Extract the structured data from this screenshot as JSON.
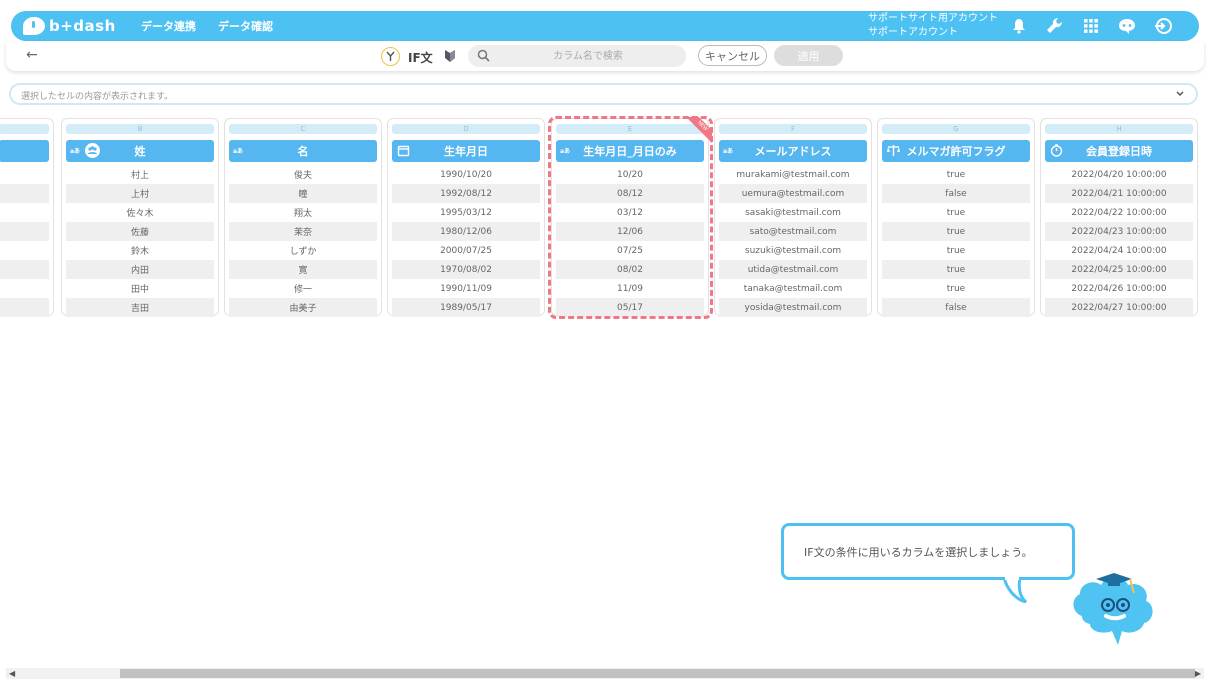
{
  "nav": {
    "logo_text": "b+dash",
    "links": [
      "データ連携",
      "データ確認"
    ],
    "account_line1": "サポートサイト用アカウント",
    "account_line2": "サポートアカウント",
    "icons": [
      "bell-icon",
      "wrench-icon",
      "grid-icon",
      "chat-icon",
      "logout-icon"
    ]
  },
  "toolbar": {
    "back_icon": "back-arrow-icon",
    "if_label": "IF文",
    "search_placeholder": "カラム名で検索",
    "cancel_label": "キャンセル",
    "apply_label": "適用"
  },
  "cell_bar": {
    "placeholder": "選択したセルの内容が表示されます。"
  },
  "columns": [
    {
      "letter": "B",
      "title": "姓",
      "type": "text",
      "cells": [
        "村上",
        "上村",
        "佐々木",
        "佐藤",
        "鈴木",
        "内田",
        "田中",
        "吉田"
      ]
    },
    {
      "letter": "C",
      "title": "名",
      "type": "text",
      "cells": [
        "俊夫",
        "瞳",
        "翔太",
        "茉奈",
        "しずか",
        "寛",
        "修一",
        "由美子"
      ]
    },
    {
      "letter": "D",
      "title": "生年月日",
      "type": "date",
      "cells": [
        "1990/10/20",
        "1992/08/12",
        "1995/03/12",
        "1980/12/06",
        "2000/07/25",
        "1970/08/02",
        "1990/11/09",
        "1989/05/17"
      ]
    },
    {
      "letter": "E",
      "title": "生年月日_月日のみ",
      "type": "text",
      "tag": "NEW",
      "cells": [
        "10/20",
        "08/12",
        "03/12",
        "12/06",
        "07/25",
        "08/02",
        "11/09",
        "05/17"
      ]
    },
    {
      "letter": "F",
      "title": "メールアドレス",
      "type": "text",
      "cells": [
        "murakami@testmail.com",
        "uemura@testmail.com",
        "sasaki@testmail.com",
        "sato@testmail.com",
        "suzuki@testmail.com",
        "utida@testmail.com",
        "tanaka@testmail.com",
        "yosida@testmail.com"
      ]
    },
    {
      "letter": "G",
      "title": "メルマガ許可フラグ",
      "type": "boolean",
      "cells": [
        "true",
        "false",
        "true",
        "true",
        "true",
        "true",
        "true",
        "false"
      ]
    },
    {
      "letter": "H",
      "title": "会員登録日時",
      "type": "datetime",
      "cells": [
        "2022/04/20 10:00:00",
        "2022/04/21 10:00:00",
        "2022/04/22 10:00:00",
        "2022/04/23 10:00:00",
        "2022/04/24 10:00:00",
        "2022/04/25 10:00:00",
        "2022/04/26 10:00:00",
        "2022/04/27 10:00:00"
      ]
    }
  ],
  "helper": {
    "message": "IF文の条件に用いるカラムを選択しましょう。"
  },
  "colors": {
    "brand": "#4ec1f3",
    "header": "#56b6ef",
    "highlight": "#f07884"
  }
}
